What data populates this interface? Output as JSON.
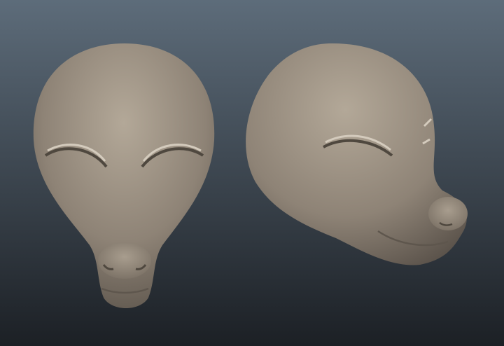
{
  "scene": {
    "colors": {
      "background_top": "#5d6c7a",
      "background_bottom": "#1c2025",
      "clay_light": "#b3a898",
      "clay_mid": "#8e8376",
      "clay_dark": "#5e564d",
      "crease": "#4f483f",
      "highlight": "#d4cbbd"
    },
    "objects": [
      {
        "name": "head-front-view",
        "material": "clay"
      },
      {
        "name": "head-three-quarter-view",
        "material": "clay"
      }
    ]
  }
}
